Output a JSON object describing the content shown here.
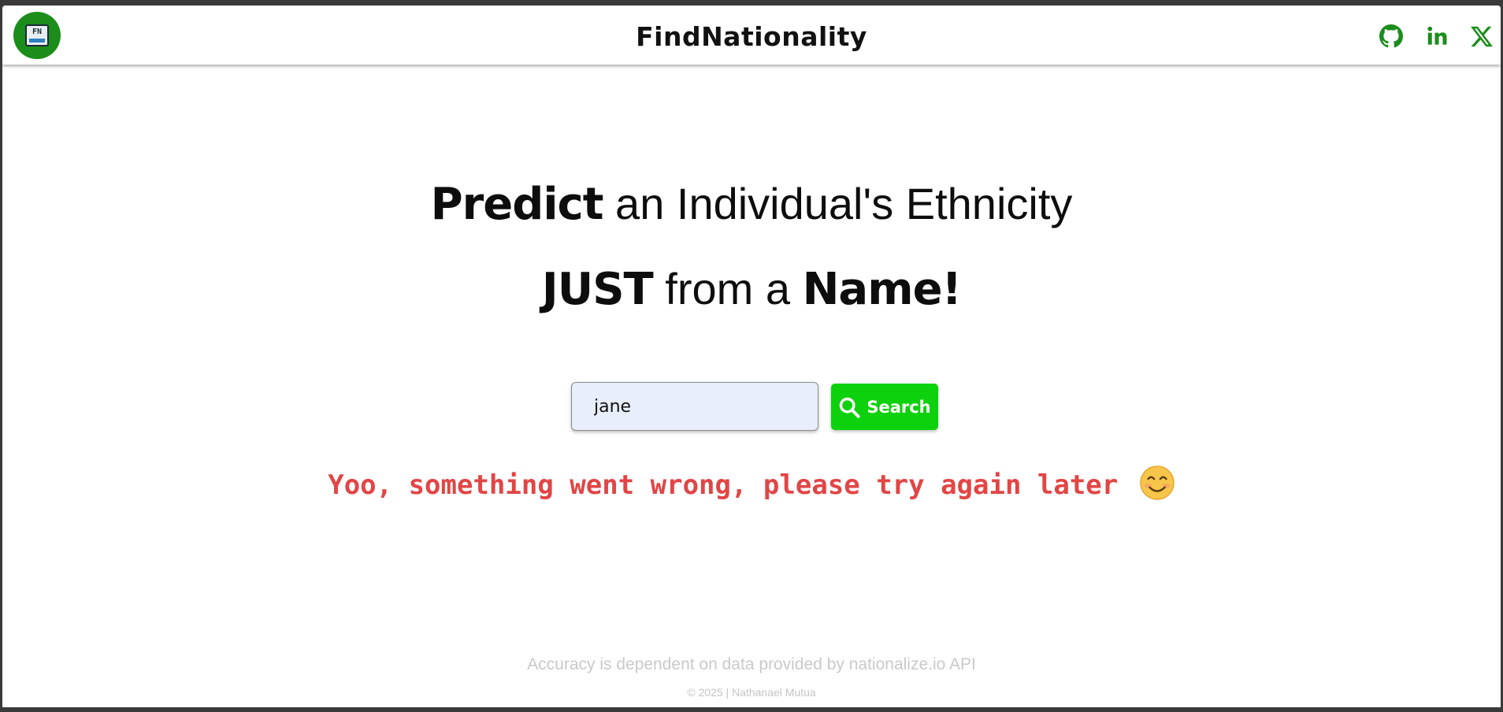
{
  "navbar": {
    "logo_text": "FN",
    "brand": "FindNationality",
    "social": [
      {
        "icon": "github-icon",
        "label": "GitHub"
      },
      {
        "icon": "linkedin-icon",
        "label": "LinkedIn"
      },
      {
        "icon": "x-twitter-icon",
        "label": "X"
      }
    ]
  },
  "hero": {
    "line1_bold": "Predict",
    "line1_rest": " an Individual's Ethnicity",
    "line2_bold1": "JUST",
    "line2_mid": " from a ",
    "line2_bold2": "Name!"
  },
  "search": {
    "value": "jane",
    "button_label": "Search"
  },
  "error": {
    "message": "Yoo, something went wrong, please try again later",
    "emoji": "smiling-face-icon"
  },
  "footer": {
    "note": "Accuracy is dependent on data provided by nationalize.io API",
    "copyright": "© 2025 | Nathanael Mutua"
  },
  "colors": {
    "accent": "#0ed10e",
    "social": "#1a8d1a",
    "error": "#e24545",
    "input_bg": "#e8eefb"
  }
}
